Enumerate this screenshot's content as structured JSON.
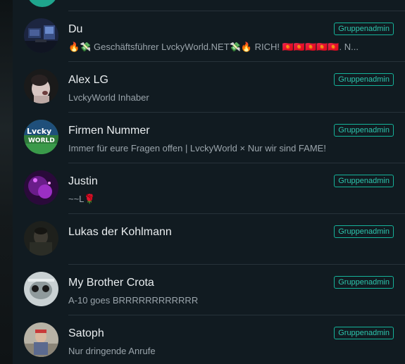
{
  "members": [
    {
      "name": "Du",
      "about": "🔥💸 Geschäftsführer LvckyWorld.NET💸🔥 RICH! 🇰🇬🇰🇬🇰🇬🇰🇬🇰🇬. N...",
      "badge": "Gruppenadmin"
    },
    {
      "name": "Alex LG",
      "about": "LvckyWorld Inhaber",
      "badge": "Gruppenadmin"
    },
    {
      "name": "Firmen Nummer",
      "about": "Immer für eure Fragen offen | LvckyWorld × Nur wir sind FAME!",
      "badge": "Gruppenadmin",
      "avatar_text": "Lvcky WORLD"
    },
    {
      "name": "Justin",
      "about": "~~L🌹",
      "badge": "Gruppenadmin"
    },
    {
      "name": "Lukas der Kohlmann",
      "about": "",
      "badge": "Gruppenadmin"
    },
    {
      "name": "My Brother Crota",
      "about": "A-10 goes BRRRRRRRRRRRR",
      "badge": "Gruppenadmin"
    },
    {
      "name": "Satoph",
      "about": "Nur dringende Anrufe",
      "badge": "Gruppenadmin"
    }
  ]
}
